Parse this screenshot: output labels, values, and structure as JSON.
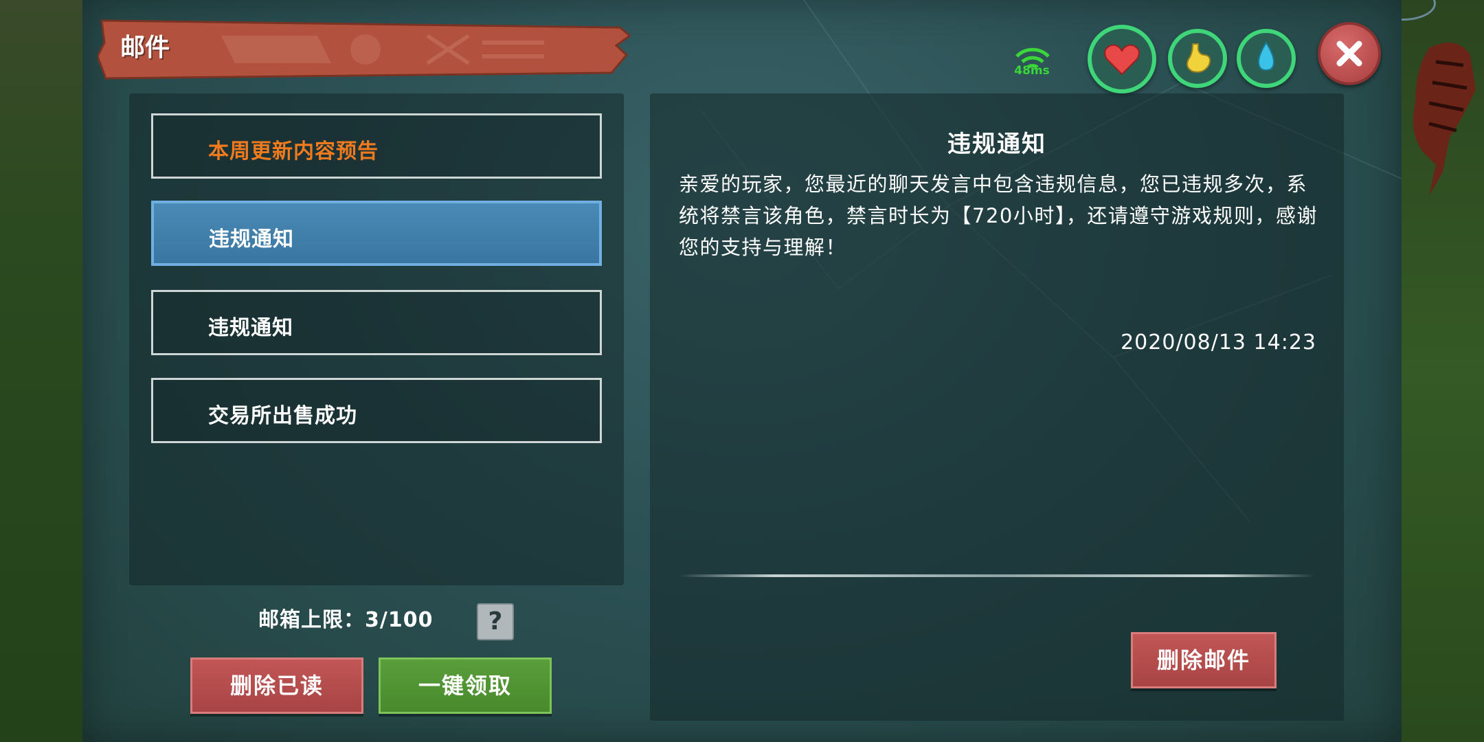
{
  "window": {
    "title": "邮件"
  },
  "status": {
    "ping_text": "48ms",
    "ping_color": "#3ad63a",
    "stats": [
      {
        "name": "health",
        "icon": "heart-icon",
        "color": "#e84848"
      },
      {
        "name": "hunger",
        "icon": "stomach-icon",
        "color": "#f0d23a"
      },
      {
        "name": "thirst",
        "icon": "water-drop-icon",
        "color": "#3ac2e8"
      }
    ],
    "stat_ring_color": "#3fd67a"
  },
  "mail_list": {
    "items": [
      {
        "label": "本周更新内容预告",
        "state": "highlight",
        "color": "#f07a1e"
      },
      {
        "label": "违规通知",
        "state": "selected"
      },
      {
        "label": "违规通知",
        "state": "normal"
      },
      {
        "label": "交易所出售成功",
        "state": "normal"
      }
    ],
    "capacity_text": "邮箱上限：3/100",
    "help_label": "?",
    "delete_read_label": "删除已读",
    "claim_all_label": "一键领取"
  },
  "detail": {
    "title": "违规通知",
    "body": "亲爱的玩家，您最近的聊天发言中包含违规信息，您已违规多次，系统将禁言该角色，禁言时长为【720小时】，还请遵守游戏规则，感谢您的支持与理解！",
    "date": "2020/08/13 14:23",
    "delete_label": "删除邮件"
  },
  "colors": {
    "panel": "#2c5155",
    "selected_item": "#3a76a2",
    "button_red": "#a84444",
    "button_green": "#488a2c",
    "title_plank": "#b2523e"
  }
}
